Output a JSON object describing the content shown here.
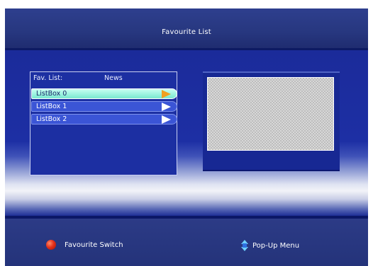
{
  "header": {
    "title": "Favourite List"
  },
  "list": {
    "label": "Fav. List:",
    "value": "News",
    "items": [
      {
        "label": "ListBox 0",
        "selected": true
      },
      {
        "label": "ListBox 1",
        "selected": false
      },
      {
        "label": "ListBox 2",
        "selected": false
      }
    ]
  },
  "footer": {
    "favourite_switch": {
      "label": "Favourite Switch",
      "icon": "red-button-icon"
    },
    "popup_menu": {
      "label": "Pop-Up Menu",
      "icon": "up-down-nav-icon"
    }
  },
  "colors": {
    "background": "#1b2a86",
    "selected_item": "#78e8cf",
    "item": "#3b55d6",
    "selected_arrow": "#f0a020",
    "red_button": "#e5311a"
  }
}
